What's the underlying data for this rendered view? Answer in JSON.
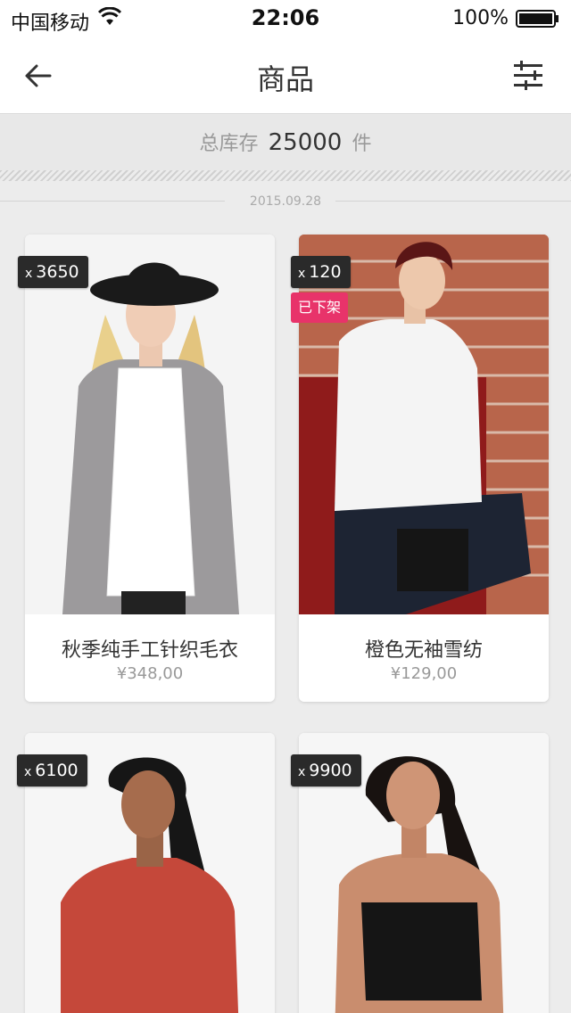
{
  "status_bar": {
    "carrier": "中国移动",
    "time": "22:06",
    "battery": "100%"
  },
  "nav": {
    "title": "商品",
    "back_icon": "arrow-left-icon",
    "filter_icon": "sliders-icon"
  },
  "summary": {
    "label": "总库存",
    "count": "25000",
    "unit": "件"
  },
  "date": "2015.09.28",
  "colors": {
    "badge_dark": "#2a2a2a",
    "badge_off": "#e8336a",
    "background": "#ececec"
  },
  "products": [
    {
      "qty_prefix": "x",
      "qty": "3650",
      "status": "",
      "name": "秋季纯手工针织毛衣",
      "price": "¥348,00"
    },
    {
      "qty_prefix": "x",
      "qty": "120",
      "status": "已下架",
      "name": "橙色无袖雪纺",
      "price": "¥129,00"
    },
    {
      "qty_prefix": "x",
      "qty": "6100",
      "status": "",
      "name": "",
      "price": ""
    },
    {
      "qty_prefix": "x",
      "qty": "9900",
      "status": "",
      "name": "",
      "price": ""
    }
  ]
}
